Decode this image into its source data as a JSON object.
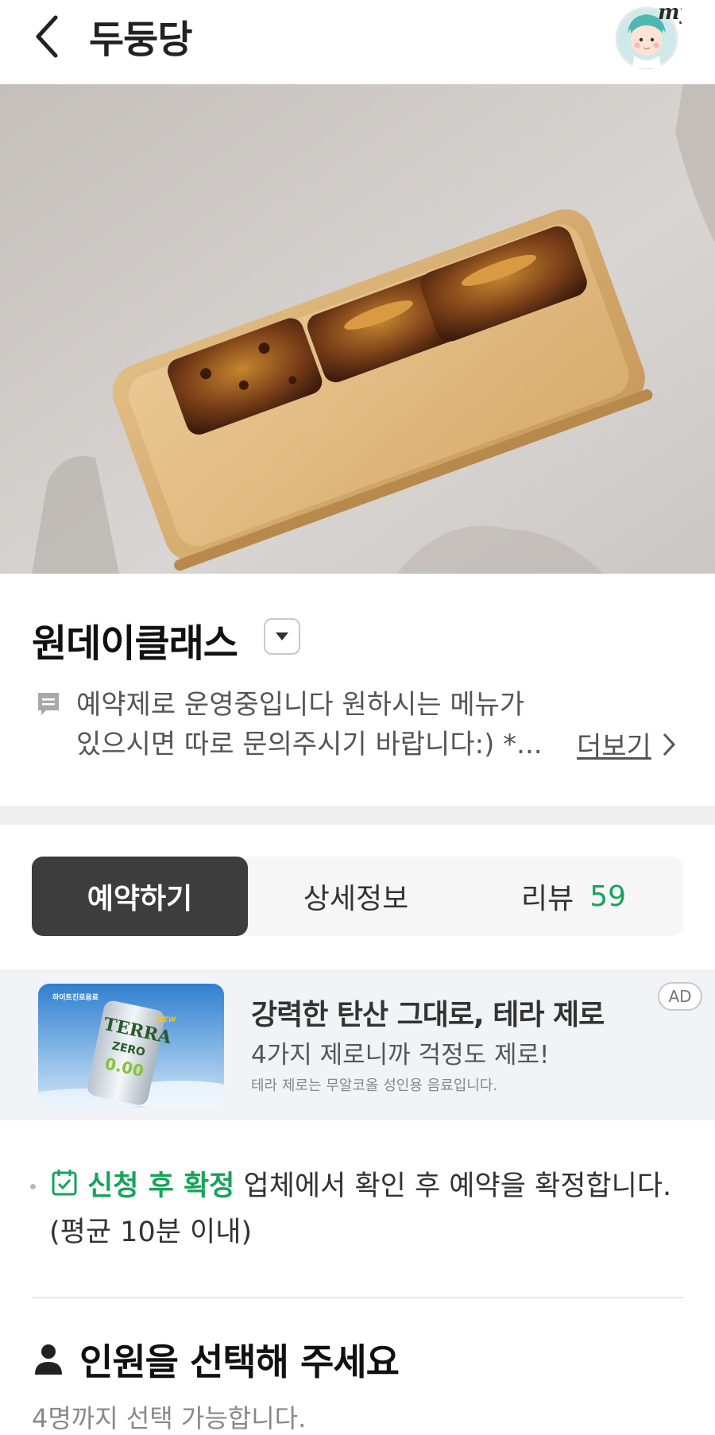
{
  "header": {
    "title": "두둥당",
    "avatar_label": "my"
  },
  "shop": {
    "name": "원데이클래스",
    "notice_line1": "예약제로 운영중입니다 원하시는 메뉴가",
    "notice_line2": "있으시면 따로 문의주시기 바랍니다:) *...",
    "more_label": "더보기"
  },
  "tabs": [
    {
      "label": "예약하기",
      "active": true
    },
    {
      "label": "상세정보",
      "active": false
    },
    {
      "label": "리뷰",
      "count": "59",
      "active": false
    }
  ],
  "ad": {
    "title": "강력한 탄산 그대로, 테라 제로",
    "subtitle": "4가지 제로니까 걱정도 제로!",
    "note": "테라 제로는 무알코올 성인용 음료입니다.",
    "badge": "AD",
    "image_brand": "하이트진로음료",
    "image_product": "TERRA",
    "image_product_sub": "ZERO",
    "image_tag": "NEW",
    "image_code": "0.00"
  },
  "confirm": {
    "tag": "신청 후 확정",
    "text": "업체에서 확인 후 예약을 확정합니다.",
    "avg": "(평균 10분 이내)"
  },
  "people": {
    "title": "인원을 선택해 주세요",
    "subtitle": "4명까지 선택 가능합니다."
  },
  "colors": {
    "accent_green": "#17a35a",
    "tab_active_bg": "#3d3d3d",
    "ad_bg": "#f2f3f6"
  },
  "icons": [
    "back-arrow-icon",
    "dropdown-arrow-icon",
    "notice-icon",
    "chevron-right-icon",
    "calendar-check-icon",
    "person-icon"
  ]
}
